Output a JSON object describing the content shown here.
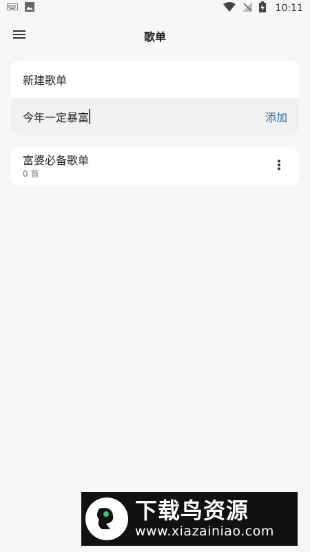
{
  "status_bar": {
    "time": "10:11",
    "left_icons": [
      "keyboard-icon",
      "image-icon"
    ],
    "right_icons": [
      "wifi-icon",
      "no-signal-icon",
      "battery-charging-icon"
    ]
  },
  "app_bar": {
    "title": "歌单",
    "menu_icon": "hamburger-menu-icon"
  },
  "new_playlist": {
    "title": "新建歌单",
    "input_value": "今年一定暴富",
    "add_label": "添加"
  },
  "playlists": [
    {
      "name": "富婆必备歌单",
      "count": "0 首",
      "more_icon": "more-vertical-icon"
    }
  ],
  "watermark": {
    "title": "下载鸟资源",
    "url": "www.xiazainiao.com"
  },
  "colors": {
    "background": "#f7f7f7",
    "card": "#ffffff",
    "input_row": "#f1f1f1",
    "accent": "#2b6cb0"
  }
}
